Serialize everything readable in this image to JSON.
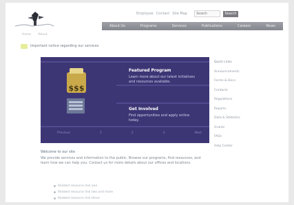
{
  "header": {
    "logo_icon": "eagle-logo-icon",
    "utility_links": [
      "Employee",
      "Contact",
      "Site Map"
    ],
    "search_placeholder": "Search",
    "search_button": "Search",
    "nav_items": [
      "About Us",
      "Programs",
      "Services",
      "Publications",
      "Careers",
      "News"
    ]
  },
  "subnav": [
    "Home",
    "About"
  ],
  "alert": {
    "icon": "notice-icon",
    "text": "Important notice regarding our services"
  },
  "hero": {
    "emblem_text": "$$$",
    "block1_title": "Featured Program",
    "block1_text": "Learn more about our latest initiatives and resources available.",
    "block2_title": "Get Involved",
    "block2_text": "Find opportunities and apply online today.",
    "footer": [
      "Previous",
      "1",
      "2",
      "3",
      "Next"
    ]
  },
  "sidebar": {
    "items": [
      "Quick Links",
      "Announcements",
      "Forms & Docs",
      "Contacts",
      "Regulations",
      "Reports",
      "Data & Statistics",
      "Grants",
      "FAQs",
      "Help Center"
    ]
  },
  "intro": {
    "title": "Welcome to our site",
    "body": "We provide services and information to the public. Browse our programs, find resources, and learn how we can help you. Contact us for more details about our offices and locations."
  },
  "links": [
    "Related resource link one",
    "Related resource link two and more",
    "Related resource link three"
  ],
  "colors": {
    "hero_bg": "#3d3675",
    "nav_bg": "#9ea0a6",
    "accent": "#c9a94a"
  }
}
